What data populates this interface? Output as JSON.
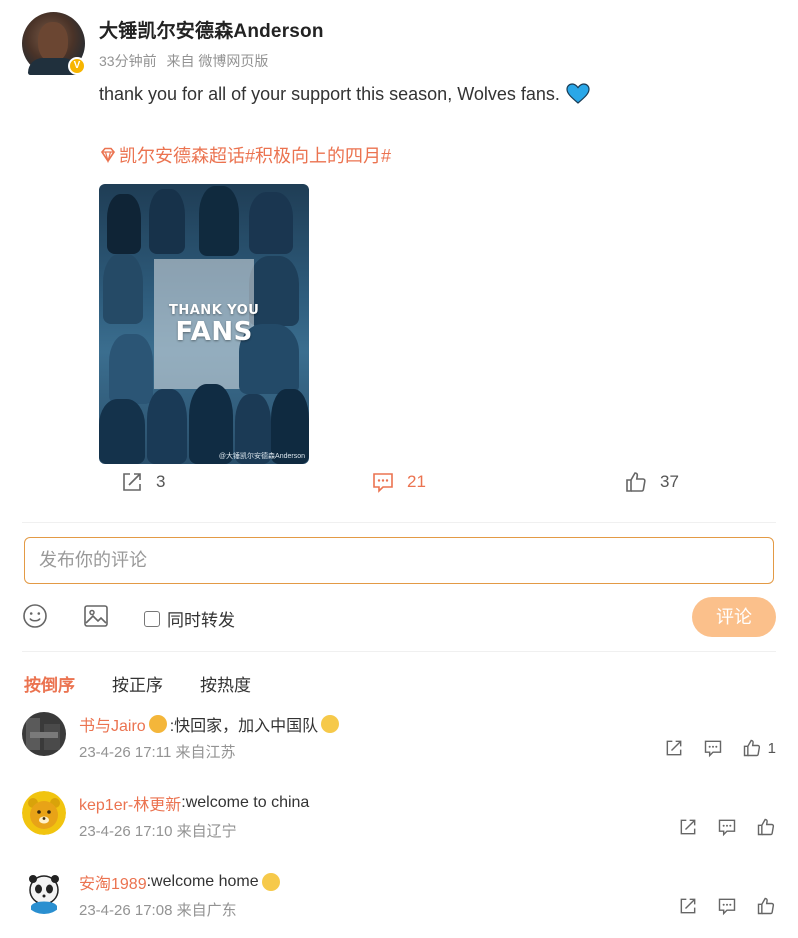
{
  "post": {
    "author_name": "大锤凯尔安德森Anderson",
    "time_ago": "33分钟前",
    "source": "来自 微博网页版",
    "text": "thank you for all of your support this season, Wolves fans.",
    "topic": "凯尔安德森超话#积极向上的四月#",
    "image_title_1": "THANK YOU",
    "image_title_2": "FANS",
    "image_watermark": "@大锤凯尔安德森Anderson",
    "colors": {
      "accent": "#eb7350",
      "heart": "#2aa7e8"
    }
  },
  "actions": {
    "repost_count": "3",
    "comment_count": "21",
    "like_count": "37"
  },
  "composer": {
    "placeholder": "发布你的评论",
    "repost_label": "同时转发",
    "submit_label": "评论",
    "icons": [
      "smile-icon",
      "image-icon"
    ]
  },
  "sort": {
    "tabs": [
      "按倒序",
      "按正序",
      "按热度"
    ],
    "active": "按倒序"
  },
  "comments": [
    {
      "user": "书与Jairo",
      "text_before": ":快回家，加入中国队",
      "time": "23-4-26 17:11",
      "location": "来自江苏",
      "like_count": "1"
    },
    {
      "user": "kep1er-林更新",
      "text_before": ":welcome to china",
      "time": "23-4-26 17:10",
      "location": "来自辽宁",
      "like_count": ""
    },
    {
      "user": "安淘1989",
      "text_before": ":welcome home",
      "time": "23-4-26 17:08",
      "location": "来自广东",
      "like_count": ""
    }
  ]
}
